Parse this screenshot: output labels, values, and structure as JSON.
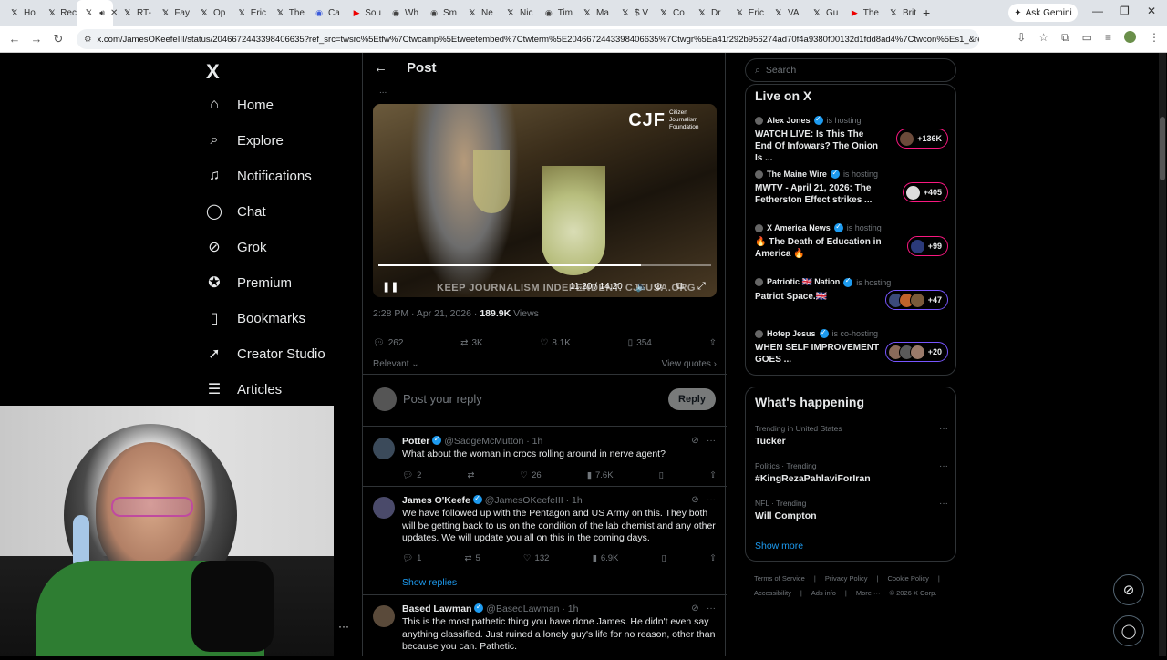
{
  "browser": {
    "tabs": [
      {
        "label": "Ho",
        "icon": "x-icon"
      },
      {
        "label": "Rec",
        "icon": "x-icon"
      },
      {
        "label": "",
        "icon": "x-icon",
        "active": true
      },
      {
        "label": "RT-",
        "icon": "x-icon"
      },
      {
        "label": "Fay",
        "icon": "x-icon"
      },
      {
        "label": "Op",
        "icon": "x-icon"
      },
      {
        "label": "Eric",
        "icon": "x-icon"
      },
      {
        "label": "The",
        "icon": "x-icon"
      },
      {
        "label": "Ca",
        "icon": "news-icon"
      },
      {
        "label": "Sou",
        "icon": "youtube-icon"
      },
      {
        "label": "Wh",
        "icon": "web-icon"
      },
      {
        "label": "Sm",
        "icon": "web-icon"
      },
      {
        "label": "Ne",
        "icon": "x-icon"
      },
      {
        "label": "Nic",
        "icon": "x-icon"
      },
      {
        "label": "Tim",
        "icon": "web-icon"
      },
      {
        "label": "Ma",
        "icon": "x-icon"
      },
      {
        "label": "$ V",
        "icon": "x-icon"
      },
      {
        "label": "Co",
        "icon": "x-icon"
      },
      {
        "label": "Dr",
        "icon": "x-icon"
      },
      {
        "label": "Eric",
        "icon": "x-icon"
      },
      {
        "label": "VA",
        "icon": "x-icon"
      },
      {
        "label": "Gu",
        "icon": "x-icon"
      },
      {
        "label": "The",
        "icon": "youtube-icon"
      },
      {
        "label": "Brit",
        "icon": "x-icon"
      }
    ],
    "ask_gemini": "Ask Gemini",
    "url": "x.com/JamesOKeefeIII/status/2046672443398406635?ref_src=twsrc%5Etfw%7Ctwcamp%5Etweetembed%7Ctwterm%5E2046672443398406635%7Ctwgr%5Ea41f292b956274ad70f4a9380f00132d1fdd8ad4%7Ctwcon%5Es1_&ref_url=htt..."
  },
  "sidebar": {
    "logo": "X",
    "items": [
      {
        "label": "Home",
        "icon": "home-icon"
      },
      {
        "label": "Explore",
        "icon": "search-icon"
      },
      {
        "label": "Notifications",
        "icon": "bell-icon"
      },
      {
        "label": "Chat",
        "icon": "chat-icon"
      },
      {
        "label": "Grok",
        "icon": "grok-icon"
      },
      {
        "label": "Premium",
        "icon": "premium-icon"
      },
      {
        "label": "Bookmarks",
        "icon": "bookmark-icon"
      },
      {
        "label": "Creator Studio",
        "icon": "rocket-icon"
      },
      {
        "label": "Articles",
        "icon": "articles-icon"
      }
    ]
  },
  "post": {
    "header_title": "Post",
    "video": {
      "brand": "CJF",
      "brand_sub": "Citizen Journalism Foundation",
      "banner": "KEEP JOURNALISM INDEPENDENT. CJFUSA.ORG",
      "time": "11:20 / 14:20",
      "progress": 0.79
    },
    "timestamp": "2:28 PM · Apr 21, 2026 · ",
    "views_count": "189.9K",
    "views_label": " Views",
    "replies": "262",
    "reposts": "3K",
    "likes": "8.1K",
    "bookmarks": "354",
    "sort_label": "Relevant",
    "view_quotes": "View quotes",
    "reply_placeholder": "Post your reply",
    "reply_button": "Reply"
  },
  "replies": [
    {
      "name": "Potter",
      "handle": "@SadgeMcMutton · 1h",
      "text": "What about the woman in crocs rolling around in nerve agent?",
      "replies": "2",
      "reposts": "",
      "likes": "26",
      "views": "7.6K"
    },
    {
      "name": "James O'Keefe",
      "handle": "@JamesOKeefeIII · 1h",
      "text": "We have followed up with the Pentagon and US Army on this. They both will be getting back to us on the condition of the lab chemist and any other updates. We will update you all on this in the coming days.",
      "replies": "1",
      "reposts": "5",
      "likes": "132",
      "views": "6.9K",
      "show_replies": "Show replies"
    },
    {
      "name": "Based Lawman",
      "handle": "@BasedLawman · 1h",
      "text": "This is the most pathetic thing you have done James. He didn't even say anything classified. Just ruined a lonely guy's life for no reason, other than because you can. Pathetic."
    }
  ],
  "right": {
    "search_placeholder": "Search",
    "live_title": "Live on X",
    "live": [
      {
        "host": "Alex Jones",
        "role": "is hosting",
        "desc": "WATCH LIVE: Is This The End Of Infowars? The Onion Is ...",
        "count": "+136K"
      },
      {
        "host": "The Maine Wire",
        "role": "is hosting",
        "desc": "MWTV - April 21, 2026: The Fetherston Effect strikes ...",
        "count": "+405"
      },
      {
        "host": "X America News",
        "role": "is hosting",
        "desc": "🔥 The Death of Education in America 🔥",
        "count": "+99"
      },
      {
        "host": "Patriotic 🇬🇧 Nation",
        "role": "is hosting",
        "desc": "Patriot Space.🇬🇧",
        "count": "+47"
      },
      {
        "host": "Hotep Jesus",
        "role": "is co-hosting",
        "desc": "WHEN SELF IMPROVEMENT GOES ...",
        "count": "+20"
      }
    ],
    "happening_title": "What's happening",
    "trends": [
      {
        "category": "Trending in United States",
        "name": "Tucker"
      },
      {
        "category": "Politics · Trending",
        "name": "#KingRezaPahlaviForIran"
      },
      {
        "category": "NFL · Trending",
        "name": "Will Compton"
      }
    ],
    "show_more": "Show more",
    "footer1": [
      "Terms of Service",
      "|",
      "Privacy Policy",
      "|",
      "Cookie Policy",
      "|"
    ],
    "footer2": [
      "Accessibility",
      "|",
      "Ads info",
      "|",
      "More ···",
      "© 2026 X Corp."
    ]
  },
  "colors": {
    "accent": "#1d9bf0",
    "live_pill": "#f91880",
    "live_pill_alt": "#7856ff"
  }
}
